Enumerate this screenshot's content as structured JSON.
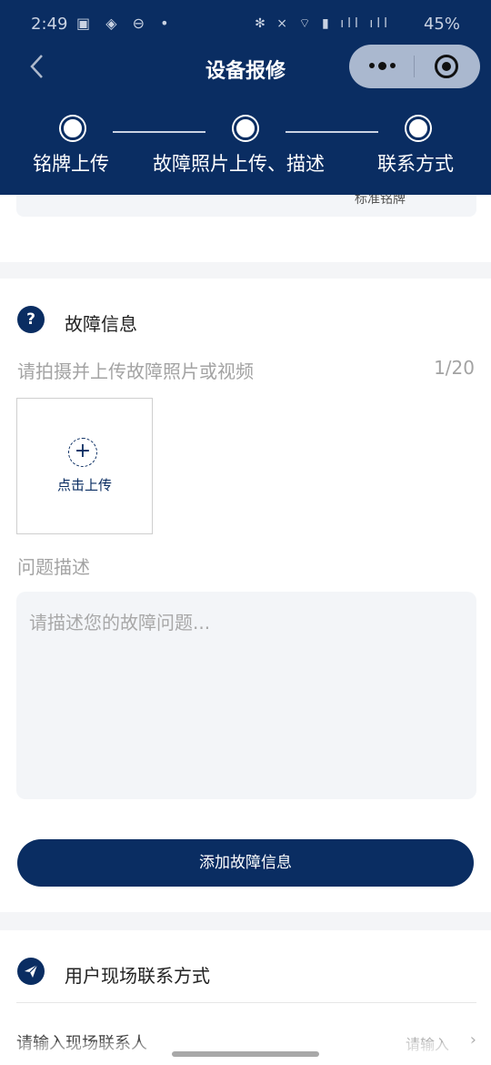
{
  "status_bar": {
    "time": "2:49",
    "battery": "45%",
    "left_icons": [
      "gallery-icon",
      "reddit-icon",
      "dnd-icon",
      "dot-icon"
    ],
    "right_icons": [
      "nfc-icon",
      "mute-icon",
      "hotspot-icon",
      "signal-icon",
      "signal-icon",
      "battery-icon"
    ]
  },
  "nav": {
    "title": "设备报修"
  },
  "steps": [
    {
      "label": "铭牌上传"
    },
    {
      "label": "故障照片上传、描述"
    },
    {
      "label": "联系方式"
    }
  ],
  "top_card": {
    "partial_text": "标准铭牌"
  },
  "fault": {
    "title": "故障信息",
    "photo_hint": "请拍摄并上传故障照片或视频",
    "photo_count": "1/20",
    "upload_label": "点击上传",
    "desc_label": "问题描述",
    "desc_placeholder": "请描述您的故障问题...",
    "add_button": "添加故障信息"
  },
  "contact": {
    "title": "用户现场联系方式",
    "field_label": "请输入现场联系人",
    "field_placeholder": "请输入"
  },
  "colors": {
    "primary": "#0a2d62",
    "background": "#f4f5f7"
  }
}
